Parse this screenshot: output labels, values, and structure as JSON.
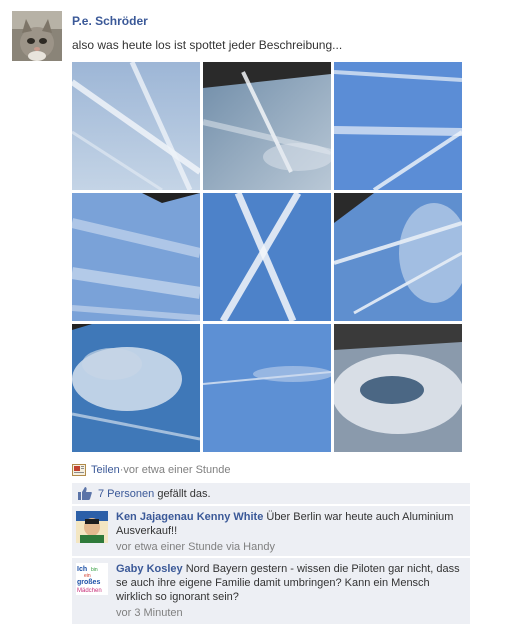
{
  "post": {
    "author": "P.e. Schröder",
    "message": "also was heute los ist spottet jeder Beschreibung..."
  },
  "photos": [
    {
      "name": "photo-1"
    },
    {
      "name": "photo-2"
    },
    {
      "name": "photo-3"
    },
    {
      "name": "photo-4"
    },
    {
      "name": "photo-5"
    },
    {
      "name": "photo-6"
    },
    {
      "name": "photo-7"
    },
    {
      "name": "photo-8"
    },
    {
      "name": "photo-9"
    }
  ],
  "actions": {
    "share_label": "Teilen",
    "separator": " · ",
    "timestamp": "vor etwa einer Stunde"
  },
  "likes": {
    "count_link": "7 Personen",
    "suffix": " gefällt das."
  },
  "comments": [
    {
      "name": "Ken Jajagenau Kenny White",
      "text": " Über Berlin war heute auch Aluminium Ausverkauf!!",
      "meta": "vor etwa einer Stunde via Handy"
    },
    {
      "name": "Gaby Kosley",
      "text": " Nord Bayern gestern - wissen die Piloten gar nicht, dass se auch ihre eigene Familie damit umbringen? Kann ein Mensch wirklich so ignorant sein?",
      "meta": "vor 3 Minuten",
      "avatar_text": [
        "Ich",
        "bin",
        "ein",
        "großes",
        "Mädchen"
      ]
    }
  ],
  "colors": {
    "link": "#3b5998",
    "meta": "#808080",
    "comment_bg": "#edeff4"
  }
}
